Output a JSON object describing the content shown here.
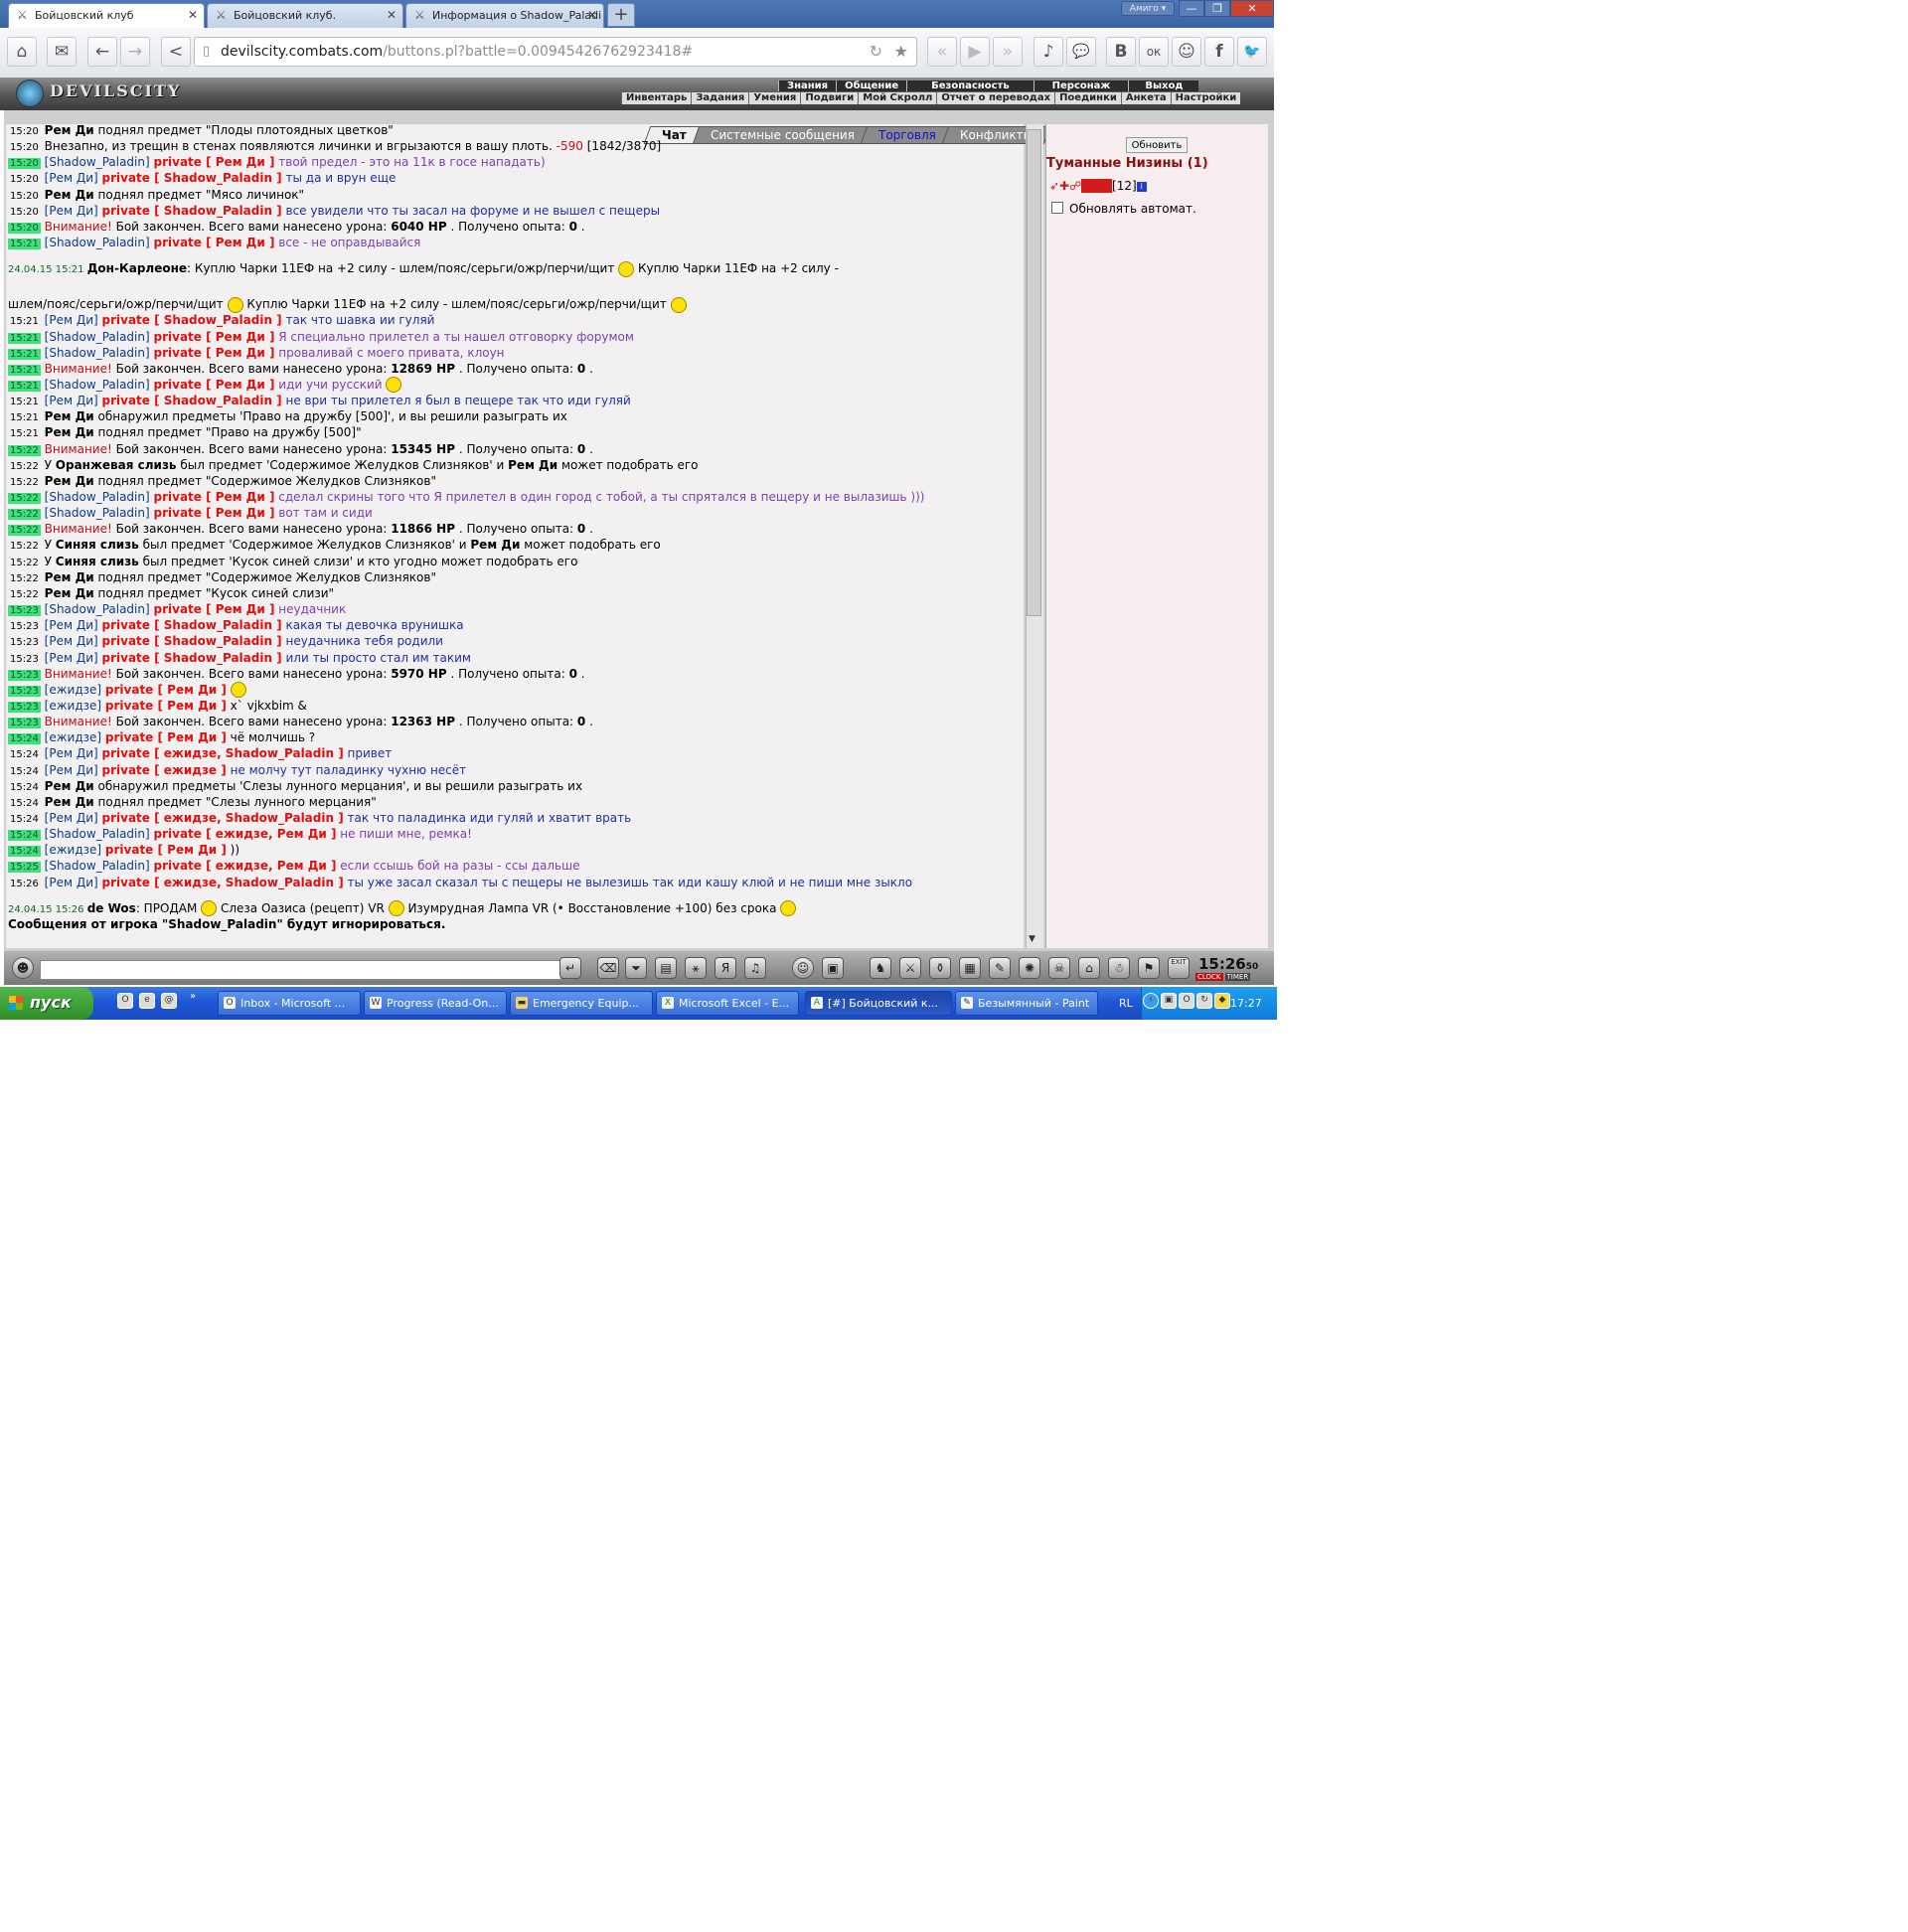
{
  "browser": {
    "tabs": [
      {
        "title": "Бойцовский клуб"
      },
      {
        "title": "Бойцовский клуб."
      },
      {
        "title": "Информация о Shadow_Paladi"
      }
    ],
    "new_tab": "+",
    "amigo_label": "Амиго ▾",
    "window_controls": [
      "—",
      "❐",
      "✕"
    ],
    "url_host": "devilscity.combats.com",
    "url_path": "/buttons.pl?battle=0.00945426762923418#",
    "social_buttons": [
      "♪",
      "💬",
      "В",
      "ок",
      "☺",
      "f",
      "🐦"
    ]
  },
  "game": {
    "logo": "DEVILSCITY",
    "nav_top": [
      "Знания",
      "Общение",
      "Безопасность",
      "Персонаж",
      "Выход"
    ],
    "nav_sub": [
      "Инвентарь",
      "Задания",
      "Умения",
      "Подвиги",
      "Мой Скролл",
      "Отчет о переводах",
      "Поединки",
      "Анкета",
      "Настройки"
    ],
    "chat_tabs": [
      "Чат",
      "Системные сообщения",
      "Торговля",
      "Конфликты"
    ]
  },
  "chat": [
    {
      "time": "15:20",
      "hl": false,
      "segments": [
        [
          "b",
          "Рем Ди"
        ],
        [
          "",
          "поднял предмет \"Плоды плотоядных цветков\""
        ]
      ]
    },
    {
      "time": "15:20",
      "hl": false,
      "segments": [
        [
          "",
          "Внезапно, из трещин в стенах появляются личинки и вгрызаются в вашу плоть. "
        ],
        [
          "red",
          "-590"
        ],
        [
          "",
          "[1842/3870]"
        ]
      ]
    },
    {
      "time": "15:20",
      "hl": true,
      "segments": [
        [
          "nm",
          "[Shadow_Paladin]"
        ],
        [
          "pr",
          "private [ Рем Ди ]"
        ],
        [
          "purple",
          "твой предел - это на 11к в госе нападать)"
        ]
      ]
    },
    {
      "time": "15:20",
      "hl": false,
      "segments": [
        [
          "nm",
          "[Рем Ди]"
        ],
        [
          "pr",
          "private [ Shadow_Paladin ]"
        ],
        [
          "blue",
          "ты да и врун еще"
        ]
      ]
    },
    {
      "time": "15:20",
      "hl": false,
      "segments": [
        [
          "b",
          "Рем Ди"
        ],
        [
          "",
          "поднял предмет \"Мясо личинок\""
        ]
      ]
    },
    {
      "time": "15:20",
      "hl": false,
      "segments": [
        [
          "nm",
          "[Рем Ди]"
        ],
        [
          "pr",
          "private [ Shadow_Paladin ]"
        ],
        [
          "blue",
          "все увидели что ты засал на форуме и не вышел с пещеры"
        ]
      ]
    },
    {
      "time": "15:20",
      "hl": true,
      "segments": [
        [
          "red",
          "Внимание!"
        ],
        [
          "",
          "Бой закончен. Всего вами нанесено урона: "
        ],
        [
          "b",
          "6040 HP"
        ],
        [
          "",
          ". Получено опыта: "
        ],
        [
          "b",
          "0"
        ],
        [
          "",
          "."
        ]
      ]
    },
    {
      "time": "15:21",
      "hl": true,
      "segments": [
        [
          "nm",
          "[Shadow_Paladin]"
        ],
        [
          "pr",
          "private [ Рем Ди ]"
        ],
        [
          "purple",
          "все - не оправдывайся"
        ]
      ]
    },
    {
      "type": "ad",
      "date": "24.04.15 15:21",
      "author": "Дон-Карлеоне",
      "text1": "Куплю Чарки 11ЕФ на +2 силу - шлем/пояс/серьги/ожр/перчи/щит",
      "text2": "Куплю Чарки 11ЕФ на +2 силу -",
      "text3": "шлем/пояс/серьги/ожр/перчи/щит",
      "text4": "Куплю Чарки 11ЕФ на +2 силу - шлем/пояс/серьги/ожр/перчи/щит"
    },
    {
      "time": "15:21",
      "hl": false,
      "segments": [
        [
          "nm",
          "[Рем Ди]"
        ],
        [
          "pr",
          "private [ Shadow_Paladin ]"
        ],
        [
          "blue",
          "так что шавка ии гуляй"
        ]
      ]
    },
    {
      "time": "15:21",
      "hl": true,
      "segments": [
        [
          "nm",
          "[Shadow_Paladin]"
        ],
        [
          "pr",
          "private [ Рем Ди ]"
        ],
        [
          "purple",
          "Я специально прилетел а ты нашел отговорку форумом"
        ]
      ]
    },
    {
      "time": "15:21",
      "hl": true,
      "segments": [
        [
          "nm",
          "[Shadow_Paladin]"
        ],
        [
          "pr",
          "private [ Рем Ди ]"
        ],
        [
          "purple",
          "проваливай с моего привата, клоун"
        ]
      ]
    },
    {
      "time": "15:21",
      "hl": true,
      "segments": [
        [
          "red",
          "Внимание!"
        ],
        [
          "",
          "Бой закончен. Всего вами нанесено урона: "
        ],
        [
          "b",
          "12869 HP"
        ],
        [
          "",
          ". Получено опыта: "
        ],
        [
          "b",
          "0"
        ],
        [
          "",
          "."
        ]
      ]
    },
    {
      "time": "15:21",
      "hl": true,
      "segments": [
        [
          "nm",
          "[Shadow_Paladin]"
        ],
        [
          "pr",
          "private [ Рем Ди ]"
        ],
        [
          "purple",
          "иди учи русский"
        ],
        [
          "smiley",
          ""
        ]
      ]
    },
    {
      "time": "15:21",
      "hl": false,
      "segments": [
        [
          "nm",
          "[Рем Ди]"
        ],
        [
          "pr",
          "private [ Shadow_Paladin ]"
        ],
        [
          "blue",
          "не ври ты прилетел я был в пещере так что иди гуляй"
        ]
      ]
    },
    {
      "time": "15:21",
      "hl": false,
      "segments": [
        [
          "b",
          "Рем Ди"
        ],
        [
          "",
          "обнаружил предметы 'Право на дружбу [500]', и вы решили разыграть их"
        ]
      ]
    },
    {
      "time": "15:21",
      "hl": false,
      "segments": [
        [
          "b",
          "Рем Ди"
        ],
        [
          "",
          "поднял предмет \"Право на дружбу [500]\""
        ]
      ]
    },
    {
      "time": "15:22",
      "hl": true,
      "segments": [
        [
          "red",
          "Внимание!"
        ],
        [
          "",
          "Бой закончен. Всего вами нанесено урона: "
        ],
        [
          "b",
          "15345 HP"
        ],
        [
          "",
          ". Получено опыта: "
        ],
        [
          "b",
          "0"
        ],
        [
          "",
          "."
        ]
      ]
    },
    {
      "time": "15:22",
      "hl": false,
      "segments": [
        [
          "",
          "У "
        ],
        [
          "b",
          "Оранжевая слизь"
        ],
        [
          "",
          "был предмет 'Содержимое Желудков Слизняков' и "
        ],
        [
          "b",
          "Рем Ди"
        ],
        [
          "",
          "может подобрать его"
        ]
      ]
    },
    {
      "time": "15:22",
      "hl": false,
      "segments": [
        [
          "b",
          "Рем Ди"
        ],
        [
          "",
          "поднял предмет \"Содержимое Желудков Слизняков\""
        ]
      ]
    },
    {
      "time": "15:22",
      "hl": true,
      "segments": [
        [
          "nm",
          "[Shadow_Paladin]"
        ],
        [
          "pr",
          "private [ Рем Ди ]"
        ],
        [
          "purple",
          "сделал скрины того что Я прилетел в один город с тобой, а ты спрятался в пещеру и не вылазишь )))"
        ]
      ]
    },
    {
      "time": "15:22",
      "hl": true,
      "segments": [
        [
          "nm",
          "[Shadow_Paladin]"
        ],
        [
          "pr",
          "private [ Рем Ди ]"
        ],
        [
          "purple",
          "вот там и сиди"
        ]
      ]
    },
    {
      "time": "15:22",
      "hl": true,
      "segments": [
        [
          "red",
          "Внимание!"
        ],
        [
          "",
          "Бой закончен. Всего вами нанесено урона: "
        ],
        [
          "b",
          "11866 HP"
        ],
        [
          "",
          ". Получено опыта: "
        ],
        [
          "b",
          "0"
        ],
        [
          "",
          "."
        ]
      ]
    },
    {
      "time": "15:22",
      "hl": false,
      "segments": [
        [
          "",
          "У "
        ],
        [
          "b",
          "Синяя слизь"
        ],
        [
          "",
          "был предмет 'Содержимое Желудков Слизняков' и "
        ],
        [
          "b",
          "Рем Ди"
        ],
        [
          "",
          "может подобрать его"
        ]
      ]
    },
    {
      "time": "15:22",
      "hl": false,
      "segments": [
        [
          "",
          "У "
        ],
        [
          "b",
          "Синяя слизь"
        ],
        [
          "",
          "был предмет 'Кусок синей слизи' и кто угодно может подобрать его"
        ]
      ]
    },
    {
      "time": "15:22",
      "hl": false,
      "segments": [
        [
          "b",
          "Рем Ди"
        ],
        [
          "",
          "поднял предмет \"Содержимое Желудков Слизняков\""
        ]
      ]
    },
    {
      "time": "15:22",
      "hl": false,
      "segments": [
        [
          "b",
          "Рем Ди"
        ],
        [
          "",
          "поднял предмет \"Кусок синей слизи\""
        ]
      ]
    },
    {
      "time": "15:23",
      "hl": true,
      "segments": [
        [
          "nm",
          "[Shadow_Paladin]"
        ],
        [
          "pr",
          "private [ Рем Ди ]"
        ],
        [
          "purple",
          "неудачник"
        ]
      ]
    },
    {
      "time": "15:23",
      "hl": false,
      "segments": [
        [
          "nm",
          "[Рем Ди]"
        ],
        [
          "pr",
          "private [ Shadow_Paladin ]"
        ],
        [
          "blue",
          "какая ты девочка врунишка"
        ]
      ]
    },
    {
      "time": "15:23",
      "hl": false,
      "segments": [
        [
          "nm",
          "[Рем Ди]"
        ],
        [
          "pr",
          "private [ Shadow_Paladin ]"
        ],
        [
          "blue",
          "неудачника тебя родили"
        ]
      ]
    },
    {
      "time": "15:23",
      "hl": false,
      "segments": [
        [
          "nm",
          "[Рем Ди]"
        ],
        [
          "pr",
          "private [ Shadow_Paladin ]"
        ],
        [
          "blue",
          "или ты просто стал им таким"
        ]
      ]
    },
    {
      "time": "15:23",
      "hl": true,
      "segments": [
        [
          "red",
          "Внимание!"
        ],
        [
          "",
          "Бой закончен. Всего вами нанесено урона: "
        ],
        [
          "b",
          "5970 HP"
        ],
        [
          "",
          ". Получено опыта: "
        ],
        [
          "b",
          "0"
        ],
        [
          "",
          "."
        ]
      ]
    },
    {
      "time": "15:23",
      "hl": true,
      "segments": [
        [
          "nm",
          "[ежидзе]"
        ],
        [
          "pr",
          "private [ Рем Ди ]"
        ],
        [
          "smiley",
          ""
        ]
      ]
    },
    {
      "time": "15:23",
      "hl": true,
      "segments": [
        [
          "nm",
          "[ежидзе]"
        ],
        [
          "pr",
          "private [ Рем Ди ]"
        ],
        [
          "",
          "x` vjkxbim &"
        ]
      ]
    },
    {
      "time": "15:23",
      "hl": true,
      "segments": [
        [
          "red",
          "Внимание!"
        ],
        [
          "",
          "Бой закончен. Всего вами нанесено урона: "
        ],
        [
          "b",
          "12363 HP"
        ],
        [
          "",
          ". Получено опыта: "
        ],
        [
          "b",
          "0"
        ],
        [
          "",
          "."
        ]
      ]
    },
    {
      "time": "15:24",
      "hl": true,
      "segments": [
        [
          "nm",
          "[ежидзе]"
        ],
        [
          "pr",
          "private [ Рем Ди ]"
        ],
        [
          "",
          "чё молчишь ?"
        ]
      ]
    },
    {
      "time": "15:24",
      "hl": false,
      "segments": [
        [
          "nm",
          "[Рем Ди]"
        ],
        [
          "pr",
          "private [ ежидзе, Shadow_Paladin ]"
        ],
        [
          "blue",
          "привет"
        ]
      ]
    },
    {
      "time": "15:24",
      "hl": false,
      "segments": [
        [
          "nm",
          "[Рем Ди]"
        ],
        [
          "pr",
          "private [ ежидзе ]"
        ],
        [
          "blue",
          "не молчу тут паладинку чухню несёт"
        ]
      ]
    },
    {
      "time": "15:24",
      "hl": false,
      "segments": [
        [
          "b",
          "Рем Ди"
        ],
        [
          "",
          "обнаружил предметы 'Слезы лунного мерцания', и вы решили разыграть их"
        ]
      ]
    },
    {
      "time": "15:24",
      "hl": false,
      "segments": [
        [
          "b",
          "Рем Ди"
        ],
        [
          "",
          "поднял предмет \"Слезы лунного мерцания\""
        ]
      ]
    },
    {
      "time": "15:24",
      "hl": false,
      "segments": [
        [
          "nm",
          "[Рем Ди]"
        ],
        [
          "pr",
          "private [ ежидзе, Shadow_Paladin ]"
        ],
        [
          "blue",
          "так что паладинка иди гуляй и хватит врать"
        ]
      ]
    },
    {
      "time": "15:24",
      "hl": true,
      "segments": [
        [
          "nm",
          "[Shadow_Paladin]"
        ],
        [
          "pr",
          "private [ ежидзе, Рем Ди ]"
        ],
        [
          "purple",
          "не пиши мне, ремка!"
        ]
      ]
    },
    {
      "time": "15:24",
      "hl": true,
      "segments": [
        [
          "nm",
          "[ежидзе]"
        ],
        [
          "pr",
          "private [ Рем Ди ]"
        ],
        [
          "",
          "))"
        ]
      ]
    },
    {
      "time": "15:25",
      "hl": true,
      "segments": [
        [
          "nm",
          "[Shadow_Paladin]"
        ],
        [
          "pr",
          "private [ ежидзе, Рем Ди ]"
        ],
        [
          "purple",
          "если ссышь бой на разы - ссы дальше"
        ]
      ]
    },
    {
      "time": "15:26",
      "hl": false,
      "segments": [
        [
          "nm",
          "[Рем Ди]"
        ],
        [
          "pr",
          "private [ ежидзе, Shadow_Paladin ]"
        ],
        [
          "blue",
          "ты уже засал сказал ты с пещеры не вылезишь так иди кашу клюй и не пиши мне зыкло"
        ]
      ]
    },
    {
      "type": "ad2",
      "date": "24.04.15 15:26",
      "author": "de Wos",
      "text": "ПРОДАМ",
      "item1": "Слеза Оазиса (рецепт) VR",
      "item2": "Изумрудная Лампа VR (• Восстановление +100) без срока"
    },
    {
      "type": "notice",
      "text": "Сообщения от игрока \"Shadow_Paladin\" будут игнорироваться."
    }
  ],
  "right_panel": {
    "refresh_label": "Обновить",
    "location": "Туманные Низины (1)",
    "player_badge": "BloK",
    "player_level": "[12]",
    "info_icon": "i",
    "auto_refresh_label": "Обновлять автомат."
  },
  "bottom": {
    "clock": "15:26",
    "clock_seconds": "50",
    "clock_label": "CLOCK",
    "timer_label": "TIMER",
    "exit_label": "EXIT"
  },
  "taskbar": {
    "start_label": "пуск",
    "tasks": [
      "Inbox - Microsoft ...",
      "Progress (Read-On...",
      "Emergency  Equip...",
      "Microsoft Excel - E...",
      "[#] Бойцовский к...",
      "Безымянный - Paint"
    ],
    "lang": "RL",
    "time": "17:27"
  }
}
